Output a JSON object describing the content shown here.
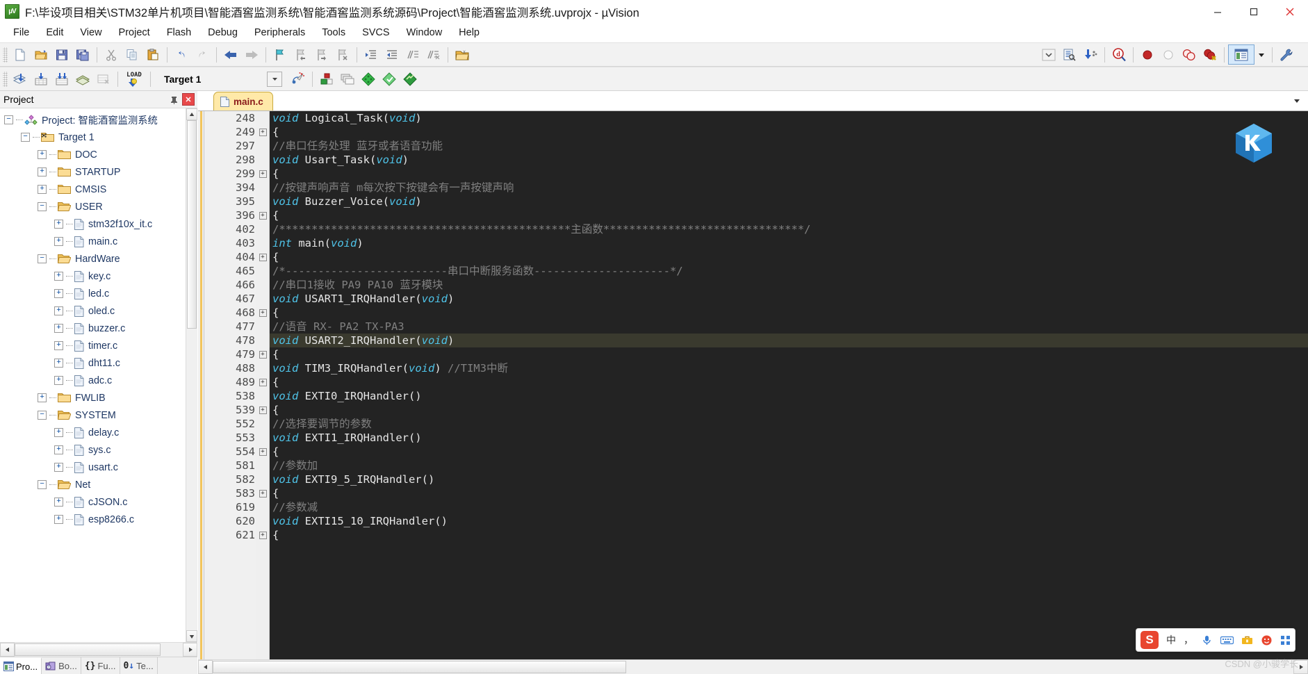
{
  "window": {
    "title": "F:\\毕设项目相关\\STM32单片机项目\\智能酒窖监测系统\\智能酒窖监测系统源码\\Project\\智能酒窖监测系统.uvprojx - µVision",
    "app_icon": "keil-uvision-icon",
    "controls": {
      "minimize": "minimize-icon",
      "maximize": "maximize-icon",
      "close": "close-icon"
    }
  },
  "menubar": {
    "items": [
      {
        "label": "File"
      },
      {
        "label": "Edit"
      },
      {
        "label": "View"
      },
      {
        "label": "Project"
      },
      {
        "label": "Flash"
      },
      {
        "label": "Debug"
      },
      {
        "label": "Peripherals"
      },
      {
        "label": "Tools"
      },
      {
        "label": "SVCS"
      },
      {
        "label": "Window"
      },
      {
        "label": "Help"
      }
    ]
  },
  "toolbar_main": {
    "groups": [
      {
        "buttons": [
          {
            "name": "new-file-icon",
            "tip": "New"
          },
          {
            "name": "open-file-icon",
            "tip": "Open"
          },
          {
            "name": "save-icon",
            "tip": "Save"
          },
          {
            "name": "save-all-icon",
            "tip": "Save All"
          }
        ]
      },
      {
        "buttons": [
          {
            "name": "cut-icon",
            "tip": "Cut"
          },
          {
            "name": "copy-icon",
            "tip": "Copy"
          },
          {
            "name": "paste-icon",
            "tip": "Paste"
          }
        ]
      },
      {
        "buttons": [
          {
            "name": "undo-icon",
            "tip": "Undo"
          },
          {
            "name": "redo-icon",
            "tip": "Redo"
          }
        ]
      },
      {
        "buttons": [
          {
            "name": "navigate-back-icon",
            "tip": "Back"
          },
          {
            "name": "navigate-forward-icon",
            "tip": "Forward"
          }
        ]
      },
      {
        "buttons": [
          {
            "name": "bookmark-toggle-icon",
            "tip": "Insert/Remove Bookmark"
          },
          {
            "name": "bookmark-prev-icon",
            "tip": "Previous Bookmark"
          },
          {
            "name": "bookmark-next-icon",
            "tip": "Next Bookmark"
          },
          {
            "name": "bookmark-clear-icon",
            "tip": "Clear All Bookmarks"
          }
        ]
      },
      {
        "buttons": [
          {
            "name": "indent-right-icon",
            "tip": "Indent"
          },
          {
            "name": "indent-left-icon",
            "tip": "Outdent"
          },
          {
            "name": "comment-icon",
            "tip": "Comment"
          },
          {
            "name": "uncomment-icon",
            "tip": "Uncomment"
          }
        ]
      },
      {
        "buttons": [
          {
            "name": "find-in-files-icon",
            "tip": "Find in Files"
          }
        ]
      },
      {
        "buttons": [
          {
            "name": "dropdown-chevron-icon",
            "tip": "More"
          },
          {
            "name": "source-browse-icon",
            "tip": "Source Browse"
          },
          {
            "name": "download-config-icon",
            "tip": "Configure"
          }
        ]
      },
      {
        "buttons": [
          {
            "name": "debug-magnifier-icon",
            "tip": "Start/Stop Debug Session"
          }
        ]
      },
      {
        "buttons": [
          {
            "name": "breakpoint-icon",
            "tip": "Insert/Remove Breakpoint"
          },
          {
            "name": "breakpoint-disable-icon",
            "tip": "Enable/Disable Breakpoint"
          },
          {
            "name": "breakpoint-disable-all-icon",
            "tip": "Disable All Breakpoints"
          },
          {
            "name": "breakpoint-kill-all-icon",
            "tip": "Kill All Breakpoints"
          }
        ]
      },
      {
        "buttons": [
          {
            "name": "project-window-icon",
            "tip": "Project Window",
            "active": true
          },
          {
            "name": "dropdown-arrow-icon",
            "tip": "Window List"
          }
        ]
      },
      {
        "buttons": [
          {
            "name": "configure-tools-icon",
            "tip": "Configuration Wizard"
          }
        ]
      }
    ]
  },
  "toolbar_build": {
    "buttons_left": [
      {
        "name": "translate-icon",
        "tip": "Translate"
      },
      {
        "name": "build-icon",
        "tip": "Build"
      },
      {
        "name": "rebuild-icon",
        "tip": "Rebuild"
      },
      {
        "name": "batch-build-icon",
        "tip": "Batch Build"
      },
      {
        "name": "stop-build-icon",
        "tip": "Stop Build"
      }
    ],
    "load_button": {
      "name": "download-load-icon",
      "label": "LOAD",
      "tip": "Download"
    },
    "target_select": {
      "value": "Target 1",
      "name": "target-selector"
    },
    "buttons_right": [
      {
        "name": "target-options-icon",
        "tip": "Options for Target"
      },
      {
        "name": "manage-components-icon",
        "tip": "Manage Project Items"
      },
      {
        "name": "multi-project-icon",
        "tip": "Manage Multi-Project Workspace"
      },
      {
        "name": "pack-installer-icon",
        "tip": "Pack Installer"
      },
      {
        "name": "manage-runtime-icon",
        "tip": "Manage Run-Time Environment"
      },
      {
        "name": "svcs-icon",
        "tip": "SVCS"
      }
    ]
  },
  "project_pane": {
    "title": "Project",
    "pin_icon": "pin-icon",
    "close_icon": "close-icon",
    "tree": [
      {
        "label": "Project: 智能酒窖监测系统",
        "depth": 0,
        "state": "expanded",
        "icon": "project-icon"
      },
      {
        "label": "Target 1",
        "depth": 1,
        "state": "expanded",
        "icon": "target-icon"
      },
      {
        "label": "DOC",
        "depth": 2,
        "state": "collapsed",
        "icon": "folder-closed-icon"
      },
      {
        "label": "STARTUP",
        "depth": 2,
        "state": "collapsed",
        "icon": "folder-closed-icon"
      },
      {
        "label": "CMSIS",
        "depth": 2,
        "state": "collapsed",
        "icon": "folder-closed-icon"
      },
      {
        "label": "USER",
        "depth": 2,
        "state": "expanded",
        "icon": "folder-open-icon"
      },
      {
        "label": "stm32f10x_it.c",
        "depth": 3,
        "state": "collapsed",
        "icon": "c-file-icon"
      },
      {
        "label": "main.c",
        "depth": 3,
        "state": "collapsed",
        "icon": "c-file-icon"
      },
      {
        "label": "HardWare",
        "depth": 2,
        "state": "expanded",
        "icon": "folder-open-icon"
      },
      {
        "label": "key.c",
        "depth": 3,
        "state": "collapsed",
        "icon": "c-file-icon"
      },
      {
        "label": "led.c",
        "depth": 3,
        "state": "collapsed",
        "icon": "c-file-icon"
      },
      {
        "label": "oled.c",
        "depth": 3,
        "state": "collapsed",
        "icon": "c-file-icon"
      },
      {
        "label": "buzzer.c",
        "depth": 3,
        "state": "collapsed",
        "icon": "c-file-icon"
      },
      {
        "label": "timer.c",
        "depth": 3,
        "state": "collapsed",
        "icon": "c-file-icon"
      },
      {
        "label": "dht11.c",
        "depth": 3,
        "state": "collapsed",
        "icon": "c-file-icon"
      },
      {
        "label": "adc.c",
        "depth": 3,
        "state": "collapsed",
        "icon": "c-file-icon"
      },
      {
        "label": "FWLIB",
        "depth": 2,
        "state": "collapsed",
        "icon": "folder-closed-icon"
      },
      {
        "label": "SYSTEM",
        "depth": 2,
        "state": "expanded",
        "icon": "folder-open-icon"
      },
      {
        "label": "delay.c",
        "depth": 3,
        "state": "collapsed",
        "icon": "c-file-icon"
      },
      {
        "label": "sys.c",
        "depth": 3,
        "state": "collapsed",
        "icon": "c-file-icon"
      },
      {
        "label": "usart.c",
        "depth": 3,
        "state": "collapsed",
        "icon": "c-file-icon"
      },
      {
        "label": "Net",
        "depth": 2,
        "state": "expanded",
        "icon": "folder-open-icon"
      },
      {
        "label": "cJSON.c",
        "depth": 3,
        "state": "collapsed",
        "icon": "c-file-icon"
      },
      {
        "label": "esp8266.c",
        "depth": 3,
        "state": "collapsed",
        "icon": "c-file-icon"
      }
    ],
    "bottom_tabs": [
      {
        "label": "Pro...",
        "icon": "project-window-icon",
        "active": true
      },
      {
        "label": "Bo...",
        "icon": "books-icon",
        "active": false
      },
      {
        "label": "Fu...",
        "icon": "functions-icon",
        "active": false
      },
      {
        "label": "Te...",
        "icon": "templates-icon",
        "active": false
      }
    ]
  },
  "editor": {
    "tabs": [
      {
        "label": "main.c",
        "icon": "c-file-icon",
        "active": true
      }
    ],
    "scroll_right_icon": "chevron-down-icon",
    "lines": [
      {
        "num": "248",
        "fold": "",
        "sep": false,
        "hl": false,
        "tokens": [
          {
            "t": "void ",
            "c": "kw"
          },
          {
            "t": "Logical_Task(",
            "c": "pl"
          },
          {
            "t": "void",
            "c": "kw"
          },
          {
            "t": ")",
            "c": "pl"
          }
        ]
      },
      {
        "num": "249",
        "fold": "+",
        "sep": false,
        "hl": false,
        "tokens": [
          {
            "t": "{",
            "c": "pl"
          }
        ]
      },
      {
        "num": "297",
        "fold": "",
        "sep": true,
        "hl": false,
        "tokens": [
          {
            "t": "//串口任务处理 蓝牙或者语音功能",
            "c": "cm"
          }
        ]
      },
      {
        "num": "298",
        "fold": "",
        "sep": false,
        "hl": false,
        "tokens": [
          {
            "t": "void ",
            "c": "kw"
          },
          {
            "t": "Usart_Task(",
            "c": "pl"
          },
          {
            "t": "void",
            "c": "kw"
          },
          {
            "t": ")",
            "c": "pl"
          }
        ]
      },
      {
        "num": "299",
        "fold": "+",
        "sep": false,
        "hl": false,
        "tokens": [
          {
            "t": "{",
            "c": "pl"
          }
        ]
      },
      {
        "num": "394",
        "fold": "",
        "sep": true,
        "hl": false,
        "tokens": [
          {
            "t": "//按键声响声音  m每次按下按键会有一声按键声响",
            "c": "cm"
          }
        ]
      },
      {
        "num": "395",
        "fold": "",
        "sep": false,
        "hl": false,
        "tokens": [
          {
            "t": "void ",
            "c": "kw"
          },
          {
            "t": "Buzzer_Voice(",
            "c": "pl"
          },
          {
            "t": "void",
            "c": "kw"
          },
          {
            "t": ")",
            "c": "pl"
          }
        ]
      },
      {
        "num": "396",
        "fold": "+",
        "sep": false,
        "hl": false,
        "tokens": [
          {
            "t": "{",
            "c": "pl"
          }
        ]
      },
      {
        "num": "402",
        "fold": "",
        "sep": true,
        "hl": false,
        "tokens": [
          {
            "t": "/*********************************************主函数*******************************/",
            "c": "cm"
          }
        ]
      },
      {
        "num": "403",
        "fold": "",
        "sep": false,
        "hl": false,
        "tokens": [
          {
            "t": "int ",
            "c": "kw"
          },
          {
            "t": "main(",
            "c": "pl"
          },
          {
            "t": "void",
            "c": "kw"
          },
          {
            "t": ")",
            "c": "pl"
          }
        ]
      },
      {
        "num": "404",
        "fold": "+",
        "sep": false,
        "hl": false,
        "tokens": [
          {
            "t": "{",
            "c": "pl"
          }
        ]
      },
      {
        "num": "465",
        "fold": "",
        "sep": true,
        "hl": false,
        "tokens": [
          {
            "t": "/*-------------------------串口中断服务函数---------------------*/",
            "c": "cm"
          }
        ]
      },
      {
        "num": "466",
        "fold": "",
        "sep": false,
        "hl": false,
        "tokens": [
          {
            "t": "//串口1接收  PA9 PA10   蓝牙模块",
            "c": "cm"
          }
        ]
      },
      {
        "num": "467",
        "fold": "",
        "sep": false,
        "hl": false,
        "tokens": [
          {
            "t": "void ",
            "c": "kw"
          },
          {
            "t": "USART1_IRQHandler(",
            "c": "pl"
          },
          {
            "t": "void",
            "c": "kw"
          },
          {
            "t": ")",
            "c": "pl"
          }
        ]
      },
      {
        "num": "468",
        "fold": "+",
        "sep": false,
        "hl": false,
        "tokens": [
          {
            "t": "{",
            "c": "pl"
          }
        ]
      },
      {
        "num": "477",
        "fold": "",
        "sep": true,
        "hl": false,
        "tokens": [
          {
            "t": "//语音 RX-  PA2  TX-PA3",
            "c": "cm"
          }
        ]
      },
      {
        "num": "478",
        "fold": "",
        "sep": false,
        "hl": true,
        "tokens": [
          {
            "t": "void ",
            "c": "kw"
          },
          {
            "t": "USART2_IRQHandler(",
            "c": "pl"
          },
          {
            "t": "void",
            "c": "kw"
          },
          {
            "t": ")",
            "c": "pl"
          }
        ]
      },
      {
        "num": "479",
        "fold": "+",
        "sep": false,
        "hl": false,
        "tokens": [
          {
            "t": "{",
            "c": "pl"
          }
        ]
      },
      {
        "num": "488",
        "fold": "",
        "sep": true,
        "hl": false,
        "tokens": [
          {
            "t": "void ",
            "c": "kw"
          },
          {
            "t": "TIM3_IRQHandler(",
            "c": "pl"
          },
          {
            "t": "void",
            "c": "kw"
          },
          {
            "t": ")    ",
            "c": "pl"
          },
          {
            "t": "//TIM3中断",
            "c": "cm"
          }
        ]
      },
      {
        "num": "489",
        "fold": "+",
        "sep": false,
        "hl": false,
        "tokens": [
          {
            "t": "{",
            "c": "pl"
          }
        ]
      },
      {
        "num": "538",
        "fold": "",
        "sep": true,
        "hl": false,
        "tokens": [
          {
            "t": "void ",
            "c": "kw"
          },
          {
            "t": "EXTI0_IRQHandler()",
            "c": "pl"
          }
        ]
      },
      {
        "num": "539",
        "fold": "+",
        "sep": false,
        "hl": false,
        "tokens": [
          {
            "t": "{",
            "c": "pl"
          }
        ]
      },
      {
        "num": "552",
        "fold": "",
        "sep": true,
        "hl": false,
        "tokens": [
          {
            "t": "//选择要调节的参数",
            "c": "cm"
          }
        ]
      },
      {
        "num": "553",
        "fold": "",
        "sep": false,
        "hl": false,
        "tokens": [
          {
            "t": "void ",
            "c": "kw"
          },
          {
            "t": "EXTI1_IRQHandler()",
            "c": "pl"
          }
        ]
      },
      {
        "num": "554",
        "fold": "+",
        "sep": false,
        "hl": false,
        "tokens": [
          {
            "t": "{",
            "c": "pl"
          }
        ]
      },
      {
        "num": "581",
        "fold": "",
        "sep": true,
        "hl": false,
        "tokens": [
          {
            "t": "//参数加",
            "c": "cm"
          }
        ]
      },
      {
        "num": "582",
        "fold": "",
        "sep": false,
        "hl": false,
        "tokens": [
          {
            "t": "void ",
            "c": "kw"
          },
          {
            "t": "EXTI9_5_IRQHandler()",
            "c": "pl"
          }
        ]
      },
      {
        "num": "583",
        "fold": "+",
        "sep": false,
        "hl": false,
        "tokens": [
          {
            "t": "{",
            "c": "pl"
          }
        ]
      },
      {
        "num": "619",
        "fold": "",
        "sep": true,
        "hl": false,
        "tokens": [
          {
            "t": "//参数减",
            "c": "cm"
          }
        ]
      },
      {
        "num": "620",
        "fold": "",
        "sep": false,
        "hl": false,
        "tokens": [
          {
            "t": "void ",
            "c": "kw"
          },
          {
            "t": "EXTI15_10_IRQHandler()",
            "c": "pl"
          }
        ]
      },
      {
        "num": "621",
        "fold": "+",
        "sep": false,
        "hl": false,
        "tokens": [
          {
            "t": "{",
            "c": "pl"
          }
        ]
      }
    ]
  },
  "ime_bar": {
    "logo": "sogou-input-icon",
    "items": [
      {
        "label": "中",
        "name": "language-mode-chinese"
      },
      {
        "label": "，",
        "name": "punctuation-mode"
      },
      {
        "label": "",
        "name": "microphone-icon"
      },
      {
        "label": "",
        "name": "keyboard-icon"
      },
      {
        "label": "",
        "name": "toolbox-icon"
      },
      {
        "label": "",
        "name": "emoji-icon"
      },
      {
        "label": "",
        "name": "menu-grid-icon"
      }
    ]
  },
  "watermark": {
    "text": "CSDN @小骏学长"
  }
}
